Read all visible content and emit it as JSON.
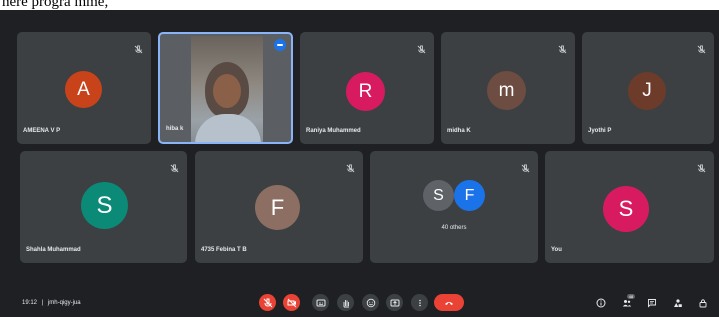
{
  "page": {
    "title_fragment": "here progra mme,"
  },
  "tiles": [
    {
      "name": "AMEENA V P",
      "initial": "A",
      "color": "#c9431a"
    },
    {
      "name": "hiba k",
      "video": true,
      "speaking": true
    },
    {
      "name": "Raniya Muhammed",
      "initial": "R",
      "color": "#d81b60"
    },
    {
      "name": "midha K",
      "initial": "m",
      "color": "#6d4c41"
    },
    {
      "name": "Jyothi P",
      "initial": "J",
      "color": "#6d3b2a"
    },
    {
      "name": "Shahla Muhammad",
      "initial": "S",
      "color": "#0b8a78"
    },
    {
      "name": "4735 Febina T B",
      "initial": "F",
      "color": "#8d6e63"
    },
    {
      "others": "40 others",
      "initials": [
        "S",
        "F"
      ],
      "colors": [
        "#5f6368",
        "#1a73e8"
      ]
    },
    {
      "name": "You",
      "initial": "S",
      "color": "#d81b60"
    }
  ],
  "bottom_bar": {
    "time": "19:12",
    "separator": "|",
    "meeting_code": "jmh-qigy-jua",
    "participants_badge": "48",
    "controls": [
      "mic-off-icon",
      "camera-off-icon",
      "captions-icon",
      "raise-hand-icon",
      "emoji-icon",
      "present-icon",
      "more-icon",
      "hang-up-icon"
    ],
    "side_icons": [
      "info-icon",
      "people-icon",
      "chat-icon",
      "activities-icon",
      "host-controls-icon"
    ]
  },
  "colors": {
    "background": "#1f2023",
    "tile": "#3c4043",
    "danger": "#ea4335",
    "active_border": "#8ab4f8"
  }
}
